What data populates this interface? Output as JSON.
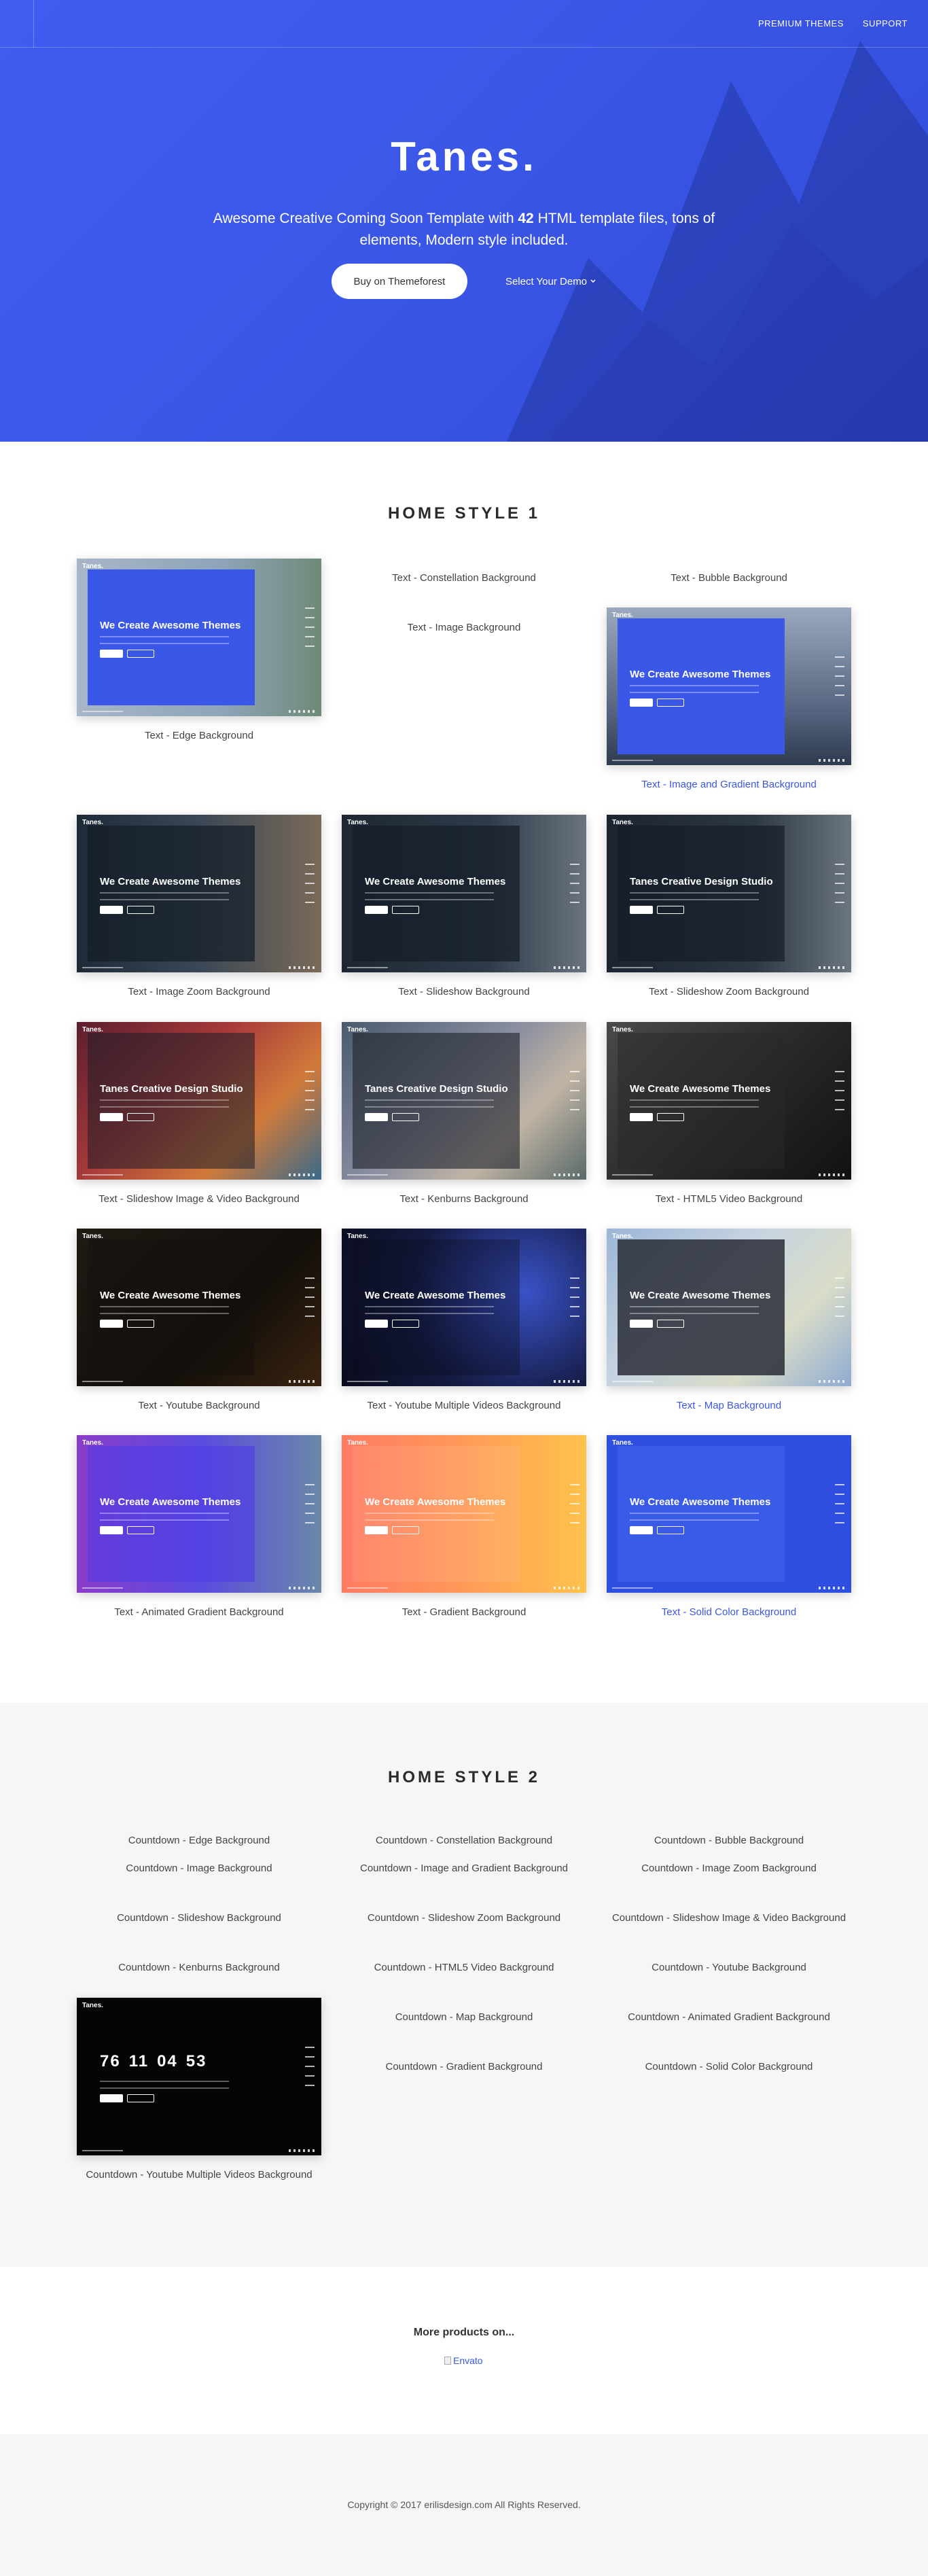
{
  "nav": {
    "items": [
      {
        "label": "PREMIUM THEMES"
      },
      {
        "label": "SUPPORT"
      }
    ]
  },
  "hero": {
    "title": "Tanes.",
    "desc_before": "Awesome Creative Coming Soon Template with ",
    "desc_number": "42",
    "desc_after": " HTML template files, tons of elements, Modern style included.",
    "buy_label": "Buy on Themeforest",
    "select_label": "Select Your Demo",
    "select_icon": "chevron-down-icon",
    "color": "#3b57e8"
  },
  "style1": {
    "title": "HOME STYLE 1",
    "thumb_heading_default": "We Create Awesome Themes",
    "thumb_heading_alt": "Tanes Creative Design Studio",
    "thumb_logo": "Tanes.",
    "items": [
      {
        "label": "Text - Edge Background"
      },
      {
        "label": "Text - Constellation Background"
      },
      {
        "label": "Text - Bubble Background"
      },
      {
        "label": "Text - Image Background"
      },
      {
        "label": "Text - Image and Gradient Background"
      },
      {
        "label": "Text - Image Zoom Background"
      },
      {
        "label": "Text - Slideshow Background"
      },
      {
        "label": "Text - Slideshow Zoom Background"
      },
      {
        "label": "Text - Slideshow Image & Video Background"
      },
      {
        "label": "Text - Kenburns Background"
      },
      {
        "label": "Text - HTML5 Video Background"
      },
      {
        "label": "Text - Youtube Background"
      },
      {
        "label": "Text - Youtube Multiple Videos Background"
      },
      {
        "label": "Text - Map Background"
      },
      {
        "label": "Text - Animated Gradient Background"
      },
      {
        "label": "Text - Gradient Background"
      },
      {
        "label": "Text - Solid Color Background"
      }
    ]
  },
  "style2": {
    "title": "HOME STYLE 2",
    "countdown": {
      "days": "76",
      "hours": "11",
      "minutes": "04",
      "seconds": "53"
    },
    "items": [
      {
        "label": "Countdown - Edge Background"
      },
      {
        "label": "Countdown - Constellation Background"
      },
      {
        "label": "Countdown - Bubble Background"
      },
      {
        "label": "Countdown - Image Background"
      },
      {
        "label": "Countdown - Image and Gradient Background"
      },
      {
        "label": "Countdown - Image Zoom Background"
      },
      {
        "label": "Countdown - Slideshow Background"
      },
      {
        "label": "Countdown - Slideshow Zoom Background"
      },
      {
        "label": "Countdown - Slideshow Image & Video Background"
      },
      {
        "label": "Countdown - Kenburns Background"
      },
      {
        "label": "Countdown - HTML5 Video Background"
      },
      {
        "label": "Countdown - Youtube Background"
      },
      {
        "label": "Countdown - Map Background"
      },
      {
        "label": "Countdown - Animated Gradient Background"
      },
      {
        "label": "Countdown - Gradient Background"
      },
      {
        "label": "Countdown - Solid Color Background"
      },
      {
        "label": "Countdown - Youtube Multiple Videos Background"
      }
    ]
  },
  "more": {
    "title": "More products on...",
    "envato_alt": "Envato"
  },
  "footer": {
    "copyright": "Copyright © 2017 erilisdesign.com All Rights Reserved."
  },
  "colors": {
    "accent": "#3a57e8",
    "band": "#f6f6f6"
  }
}
